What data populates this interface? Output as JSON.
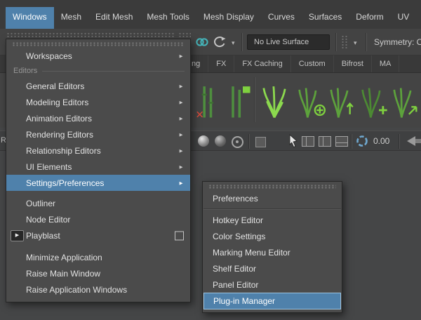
{
  "colors": {
    "highlight_blue": "#4f81ab",
    "menu_bg": "#4b4b4b",
    "bar_bg": "#3b3b3b",
    "canvas_bg": "#454647",
    "combo_bg": "#2b2b2b"
  },
  "icons": {
    "submenu_arrow": "►",
    "dropdown_caret": "▾",
    "play": "▶",
    "names": [
      "dot-grip-handle",
      "link-icon",
      "curved-arrow-icon",
      "dropdown-caret-icon",
      "sphere-icon",
      "wire-circle-icon",
      "select-cursor-icon",
      "panel-layout-icon",
      "aperture-icon",
      "cone-icon",
      "grass-shelf-icon",
      "playblast-icon",
      "option-box"
    ]
  },
  "menubar": {
    "items": [
      {
        "label": "Windows",
        "active": true
      },
      {
        "label": "Mesh"
      },
      {
        "label": "Edit Mesh"
      },
      {
        "label": "Mesh Tools"
      },
      {
        "label": "Mesh Display"
      },
      {
        "label": "Curves"
      },
      {
        "label": "Surfaces"
      },
      {
        "label": "Deform"
      },
      {
        "label": "UV"
      }
    ]
  },
  "status_line": {
    "live_surface": "No Live Surface",
    "symmetry": "Symmetry: O"
  },
  "shelf_tabs": {
    "items": [
      {
        "label": "ng"
      },
      {
        "label": "FX"
      },
      {
        "label": "FX Caching"
      },
      {
        "label": "Custom"
      },
      {
        "label": "Bifrost"
      },
      {
        "label": "MA"
      }
    ]
  },
  "secondary_toolbar": {
    "left_text": "Re",
    "value": "0.00"
  },
  "windows_menu": {
    "section_label": "Editors",
    "items": [
      {
        "label": "Workspaces",
        "submenu": true
      },
      {
        "label": "General Editors",
        "submenu": true
      },
      {
        "label": "Modeling Editors",
        "submenu": true
      },
      {
        "label": "Animation Editors",
        "submenu": true
      },
      {
        "label": "Rendering Editors",
        "submenu": true
      },
      {
        "label": "Relationship Editors",
        "submenu": true
      },
      {
        "label": "UI Elements",
        "submenu": true
      },
      {
        "label": "Settings/Preferences",
        "submenu": true,
        "highlighted": true
      },
      {
        "label": "Outliner"
      },
      {
        "label": "Node Editor"
      },
      {
        "label": "Playblast",
        "option_box": true
      },
      {
        "label": "Minimize Application"
      },
      {
        "label": "Raise Main Window"
      },
      {
        "label": "Raise Application Windows"
      }
    ]
  },
  "settings_submenu": {
    "items": [
      {
        "label": "Preferences"
      },
      {
        "label": "Hotkey Editor"
      },
      {
        "label": "Color Settings"
      },
      {
        "label": "Marking Menu Editor"
      },
      {
        "label": "Shelf Editor"
      },
      {
        "label": "Panel Editor"
      },
      {
        "label": "Plug-in Manager",
        "highlighted": true
      }
    ]
  }
}
